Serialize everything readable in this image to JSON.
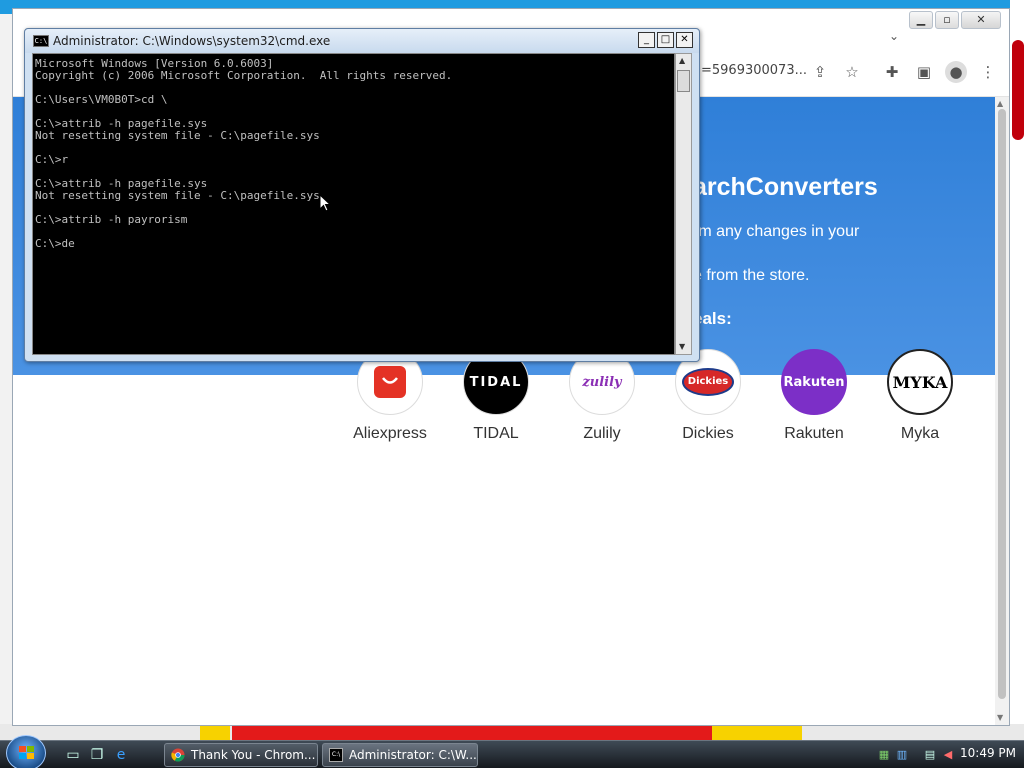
{
  "browser": {
    "url_fragment": "=5969300073...",
    "banner": {
      "title": "archConverters",
      "text1": "rm any changes in your",
      "text2": "e from the store.",
      "deals": "eals:"
    },
    "stores": [
      {
        "name": "Aliexpress",
        "logo_text": "",
        "logo_bg": "#ffffff"
      },
      {
        "name": "TIDAL",
        "logo_text": "TIDAL",
        "logo_bg": "#000000"
      },
      {
        "name": "Zulily",
        "logo_text": "zulily",
        "logo_bg": "#ffffff"
      },
      {
        "name": "Dickies",
        "logo_text": "Dickies",
        "logo_bg": "#ffffff"
      },
      {
        "name": "Rakuten",
        "logo_text": "Rakuten",
        "logo_bg": "#7c2fc7"
      },
      {
        "name": "Myka",
        "logo_text": "MYKA",
        "logo_bg": "#ffffff"
      }
    ]
  },
  "cmd": {
    "title": "Administrator: C:\\Windows\\system32\\cmd.exe",
    "lines": [
      "Microsoft Windows [Version 6.0.6003]",
      "Copyright (c) 2006 Microsoft Corporation.  All rights reserved.",
      "",
      "C:\\Users\\VM0B0T>cd \\",
      "",
      "C:\\>attrib -h pagefile.sys",
      "Not resetting system file - C:\\pagefile.sys",
      "",
      "C:\\>r",
      "",
      "C:\\>attrib -h pagefile.sys",
      "Not resetting system file - C:\\pagefile.sys",
      "",
      "C:\\>attrib -h payrorism",
      "",
      "C:\\>de"
    ]
  },
  "taskbar": {
    "tasks": [
      {
        "label": "Thank You - Chrom...",
        "icon": "chrome-icon"
      },
      {
        "label": "Administrator: C:\\W...",
        "icon": "cmd-icon"
      }
    ],
    "clock": "10:49 PM"
  }
}
